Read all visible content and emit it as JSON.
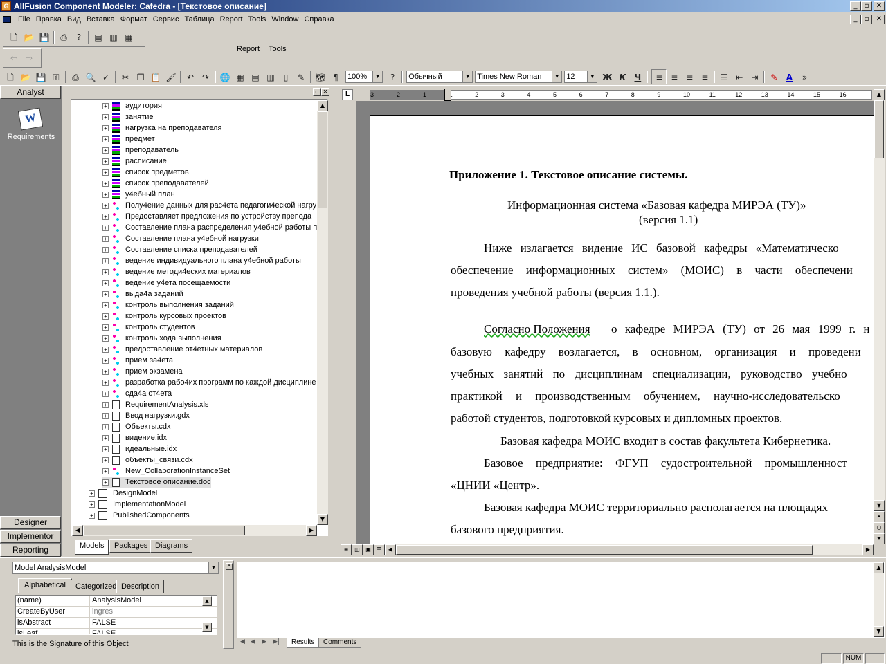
{
  "window": {
    "title": "AllFusion Component Modeler: Cafedra - [Текстовое описание]",
    "app_icon_letter": "G",
    "min": "_",
    "max": "▫",
    "close": "✕"
  },
  "menu": [
    "File",
    "Правка",
    "Вид",
    "Вставка",
    "Формат",
    "Сервис",
    "Таблица",
    "Report",
    "Tools",
    "Window",
    "Справка"
  ],
  "toolbar2": {
    "report": "Report",
    "tools": "Tools"
  },
  "format": {
    "zoom": "100%",
    "style": "Обычный",
    "font": "Times New Roman",
    "size": "12",
    "bold": "Ж",
    "italic": "К",
    "underline": "Ч"
  },
  "leftbar": {
    "analyst": "Analyst",
    "requirements": "Requirements",
    "designer": "Designer",
    "implementor": "Implementor",
    "reporting": "Reporting"
  },
  "tree": [
    {
      "t": "аудитория",
      "i": "ent"
    },
    {
      "t": "занятие",
      "i": "ent"
    },
    {
      "t": "нагрузка на преподавателя",
      "i": "ent"
    },
    {
      "t": "предмет",
      "i": "ent"
    },
    {
      "t": "преподаватель",
      "i": "ent"
    },
    {
      "t": "расписание",
      "i": "ent"
    },
    {
      "t": "список предметов",
      "i": "ent"
    },
    {
      "t": "список преподавателей",
      "i": "ent"
    },
    {
      "t": "у4ебный план",
      "i": "ent"
    },
    {
      "t": "Полу4ение данных для рас4ета педагоги4еской нагру",
      "i": "uc"
    },
    {
      "t": "Предоставляет предложения по устройству препода",
      "i": "uc"
    },
    {
      "t": "Составление плана распределения у4ебной работы п",
      "i": "uc"
    },
    {
      "t": "Составление плана у4ебной нагрузки",
      "i": "uc"
    },
    {
      "t": "Составление списка преподавателей",
      "i": "uc"
    },
    {
      "t": "ведение индивидуального плана у4ебной работы",
      "i": "uc"
    },
    {
      "t": "ведение методи4еских материалов",
      "i": "uc"
    },
    {
      "t": "ведение у4ета посещаемости",
      "i": "uc"
    },
    {
      "t": "выда4а заданий",
      "i": "uc"
    },
    {
      "t": "контроль выполнения заданий",
      "i": "uc"
    },
    {
      "t": "контроль курсовых проектов",
      "i": "uc"
    },
    {
      "t": "контроль студентов",
      "i": "uc"
    },
    {
      "t": "контроль хода выполнения",
      "i": "uc"
    },
    {
      "t": "предоставление от4етных материалов",
      "i": "uc"
    },
    {
      "t": "прием за4ета",
      "i": "uc"
    },
    {
      "t": "прием экзамена",
      "i": "uc"
    },
    {
      "t": "разработка рабо4их программ по каждой дисциплине",
      "i": "uc"
    },
    {
      "t": "сда4а от4ета",
      "i": "uc"
    },
    {
      "t": "RequirementAnalysis.xls",
      "i": "doc"
    },
    {
      "t": "Ввод нагрузки.gdx",
      "i": "doc"
    },
    {
      "t": "Объекты.cdx",
      "i": "doc"
    },
    {
      "t": "видение.idx",
      "i": "doc"
    },
    {
      "t": "идеальные.idx",
      "i": "doc"
    },
    {
      "t": "объекты_связи.cdx",
      "i": "doc"
    },
    {
      "t": "New_CollaborationInstanceSet",
      "i": "uc"
    },
    {
      "t": "Текстовое описание.doc",
      "i": "doc"
    }
  ],
  "tree_root": [
    "DesignModel",
    "ImplementationModel",
    "PublishedComponents"
  ],
  "tree_tabs": [
    "Models",
    "Packages",
    "Diagrams"
  ],
  "ruler": [
    "3",
    "2",
    "1",
    "1",
    "2",
    "3",
    "4",
    "5",
    "6",
    "7",
    "8",
    "9",
    "10",
    "11",
    "12",
    "13",
    "14",
    "15",
    "16"
  ],
  "document": {
    "heading": "Приложение 1. Текстовое описание системы.",
    "sys1": "Информационная система «Базовая кафедра МИРЭА (ТУ)»",
    "sys2": "(версия 1.1)",
    "p1": [
      "Ниже излагается видение ИС базовой кафедры «Математическо",
      "обеспечение информационных систем» (МОИС) в части обеспечени",
      "проведения учебной работы (версия 1.1.)."
    ],
    "p2_u": "Согласно Положения",
    "p2": [
      "о кафедре МИРЭА (ТУ) от 26 мая 1999 г. н",
      "базовую кафедру возлагается, в основном, организация и проведени",
      "учебных занятий по дисциплинам специализации, руководство учебно",
      "практикой и производственным обучением, научно-исследовательско",
      "работой студентов, подготовкой курсовых и дипломных проектов."
    ],
    "p3": "Базовая кафедра МОИС входит в состав факультета Кибернетика.",
    "p4": [
      "Базовое предприятие: ФГУП судостроительной промышленност",
      "«ЦНИИ «Центр»."
    ],
    "p5": [
      "Базовая кафедра МОИС территориально располагается на площадях",
      "базового предприятия."
    ]
  },
  "props": {
    "model": "Model AnalysisModel",
    "tabs": [
      "Alphabetical",
      "Categorized",
      "Description"
    ],
    "rows": [
      [
        "(name)",
        "AnalysisModel"
      ],
      [
        "CreateByUser",
        "ingres"
      ],
      [
        "isAbstract",
        "FALSE"
      ],
      [
        "isLeaf",
        "FALSE"
      ]
    ],
    "status": "This is the Signature of this Object"
  },
  "output": {
    "tabs": [
      "Results",
      "Comments"
    ]
  },
  "statusbar": {
    "num": "NUM"
  }
}
